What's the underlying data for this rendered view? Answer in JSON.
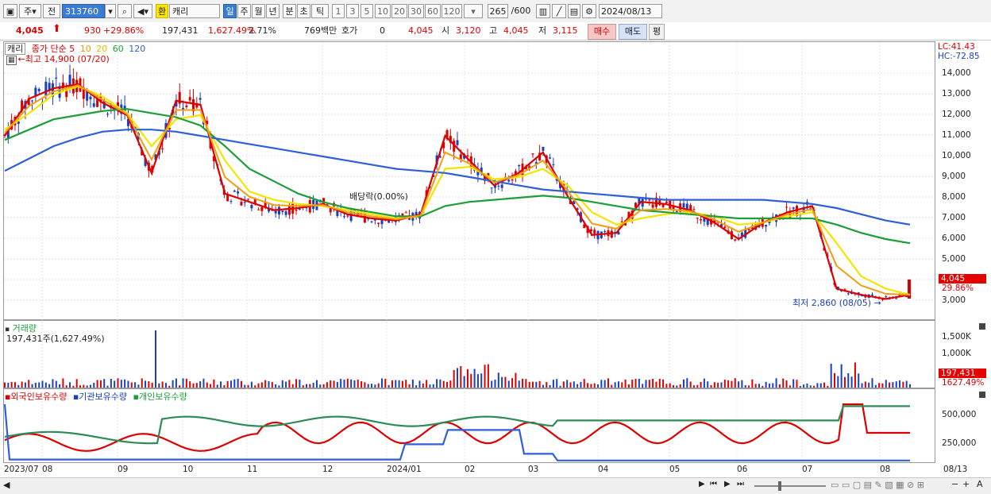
{
  "toolbar": {
    "market": "주",
    "prev": "전",
    "code": "313760",
    "stock_name": "캐리",
    "hanja_badge": "환",
    "periods": [
      "일",
      "주",
      "월",
      "년",
      "분",
      "초",
      "틱"
    ],
    "active_period": "일",
    "counts": [
      "1",
      "3",
      "5",
      "10",
      "20",
      "30",
      "60",
      "120"
    ],
    "range": "265",
    "range_total": "/600",
    "date": "2024/08/13"
  },
  "infobar": {
    "price": "4,045",
    "change": "930",
    "change_pct": "+29.86%",
    "volume": "197,431",
    "volume_ratio": "1,627.49%",
    "turnover": "2.71%",
    "amount": "769백만",
    "quote_label": "호가",
    "quote_value": "0",
    "quote_price": "4,045",
    "open_label": "시",
    "open": "3,120",
    "high_label": "고",
    "high": "4,045",
    "low_label": "저",
    "low": "3,115",
    "buy_btn": "매수",
    "sell_btn": "매도",
    "eval_btn": "평"
  },
  "price_panel": {
    "name": "캐리",
    "legend": "종가 단순",
    "ma_periods": [
      "5",
      "10",
      "20",
      "60",
      "120"
    ],
    "high_note": "←최고 14,900 (07/20)",
    "low_note": "최저 2,860 (08/05)",
    "dividend_note": "배당락(0.00%)",
    "lc": "LC:41.43",
    "hc": "HC:-72.85",
    "y_ticks": [
      "14,000",
      "13,000",
      "12,000",
      "11,000",
      "10,000",
      "9,000",
      "8,000",
      "7,000",
      "6,000",
      "5,000",
      "3,000"
    ],
    "current_badge": "4,045",
    "current_pct": "29.86%"
  },
  "volume_panel": {
    "title": "거래량",
    "value": "197,431주(1,627.49%)",
    "y_ticks": [
      "1,500K",
      "1,000K"
    ],
    "badge": "197,431",
    "badge_pct": "1627.49%"
  },
  "holdings_panel": {
    "series": [
      "외국인보유수량",
      "기관보유수량",
      "개인보유수량"
    ],
    "y_ticks": [
      "500,000",
      "250,000"
    ]
  },
  "x_axis": [
    "2023/07",
    "08",
    "09",
    "10",
    "11",
    "12",
    "2024/01",
    "02",
    "03",
    "04",
    "05",
    "06",
    "07",
    "08",
    "08/13"
  ],
  "colors": {
    "ma5": "#dd0000",
    "ma10": "#f39c12",
    "ma20": "#f2e600",
    "ma60": "#1e9e3a",
    "ma120": "#2f5fd8",
    "up": "#dd0000",
    "down": "#1a3fbf"
  },
  "chart_data": {
    "type": "line",
    "title": "캐리 313760",
    "x_range": [
      "2023/07",
      "2024/08/13"
    ],
    "price_ylim": [
      2500,
      15000
    ],
    "ma_lines": [
      {
        "name": "5",
        "values": [
          11000,
          12800,
          13300,
          13500,
          12600,
          12000,
          9200,
          12700,
          12500,
          8200,
          7800,
          7400,
          7500,
          7700,
          7200,
          7000,
          6900,
          7200,
          11000,
          9800,
          8600,
          9200,
          10200,
          8100,
          6200,
          6300,
          7800,
          7700,
          7400,
          6800,
          6000,
          6800,
          7300,
          7600,
          3600,
          3300,
          3100,
          3300
        ]
      },
      {
        "name": "20",
        "values": [
          11300,
          12100,
          13000,
          13400,
          12900,
          12100,
          10500,
          11800,
          12000,
          9800,
          8300,
          7900,
          7700,
          7600,
          7400,
          7200,
          7000,
          7100,
          9400,
          9500,
          8900,
          9000,
          9400,
          8600,
          7300,
          6700,
          7000,
          7200,
          7300,
          7100,
          6700,
          6800,
          7100,
          7300,
          5800,
          4200,
          3600,
          3300
        ]
      },
      {
        "name": "60",
        "values": [
          10800,
          11300,
          11800,
          12000,
          12200,
          12300,
          12100,
          11900,
          11500,
          10500,
          9400,
          8800,
          8200,
          7800,
          7500,
          7300,
          7100,
          7100,
          7600,
          7800,
          7900,
          8000,
          8100,
          8000,
          7800,
          7600,
          7400,
          7300,
          7200,
          7100,
          7000,
          7000,
          7000,
          7000,
          6700,
          6300,
          6000,
          5800
        ]
      },
      {
        "name": "120",
        "values": [
          9300,
          9900,
          10500,
          10900,
          11200,
          11300,
          11300,
          11200,
          11000,
          10800,
          10600,
          10400,
          10200,
          10000,
          9800,
          9600,
          9400,
          9300,
          9200,
          9000,
          8800,
          8600,
          8400,
          8300,
          8200,
          8100,
          8000,
          7900,
          7900,
          7900,
          7900,
          7900,
          7800,
          7700,
          7500,
          7200,
          6900,
          6700
        ]
      }
    ],
    "price_extremes": {
      "high": 14900,
      "high_date": "07/20",
      "low": 2860,
      "low_date": "08/05",
      "last": 4045
    }
  }
}
